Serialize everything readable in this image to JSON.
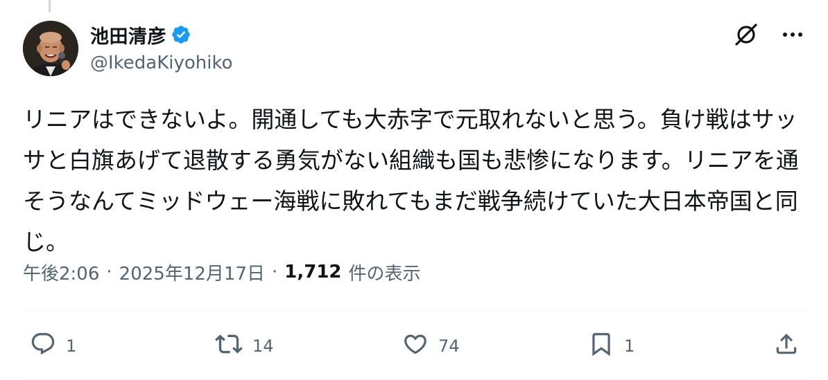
{
  "author": {
    "display_name": "池田清彦",
    "handle": "@IkedaKiyohiko",
    "verified": true
  },
  "tweet": {
    "text": "リニアはできないよ。開通しても大赤字で元取れないと思う。負け戦はサッサと白旗あげて退散する勇気がない組織も国も悲惨になります。リニアを通そうなんてミッドウェー海戦に敗れてもまだ戦争続けていた大日本帝国と同じ。",
    "time": "午後2:06",
    "date": "2025年12月17日",
    "views_count": "1,712",
    "views_label": "件の表示",
    "separator": "·"
  },
  "actions": {
    "replies": "1",
    "retweets": "14",
    "likes": "74",
    "bookmarks": "1"
  },
  "colors": {
    "text": "#0f1419",
    "secondary": "#536471",
    "verified": "#1d9bf0",
    "divider": "#eff3f4"
  },
  "icons": [
    "grok-icon",
    "more-icon",
    "reply-icon",
    "retweet-icon",
    "like-icon",
    "bookmark-icon",
    "share-icon"
  ]
}
